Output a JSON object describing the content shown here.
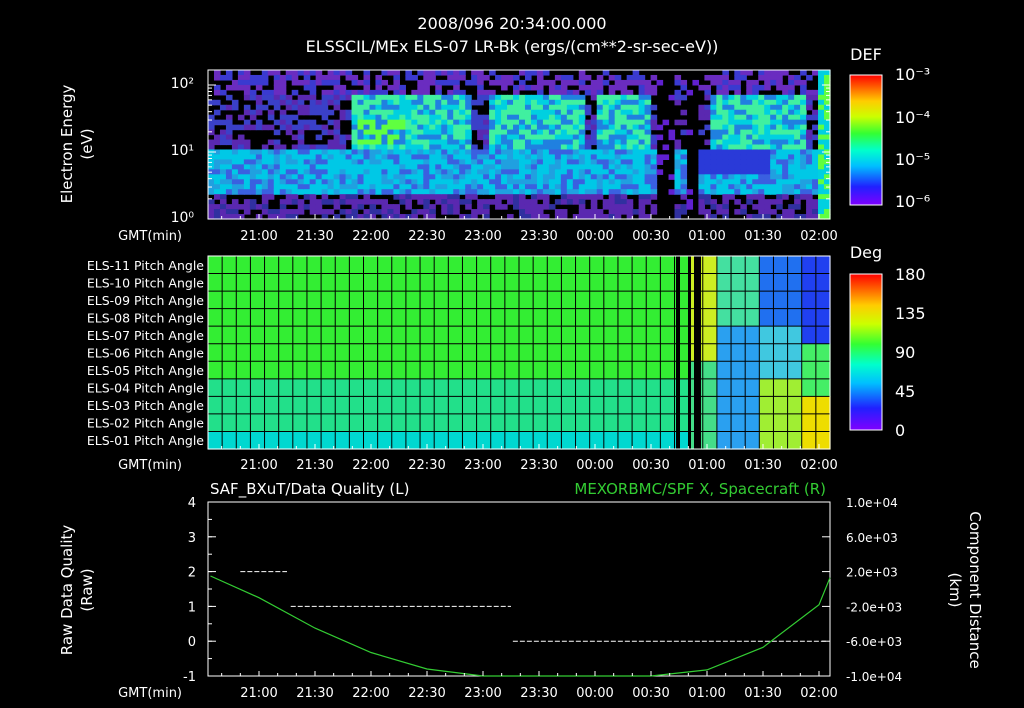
{
  "header": {
    "timestamp": "2008/096 20:34:00.000",
    "title": "ELSSCIL/MEx ELS-07 LR-Bk  (ergs/(cm**2-sr-sec-eV))"
  },
  "colors": {
    "background": "#000000",
    "axis": "#ffffff",
    "line_green": "#33cc33",
    "colorbar": [
      "#7f00ff",
      "#2020ff",
      "#00bfff",
      "#00ffcc",
      "#33ff33",
      "#ccff00",
      "#ffcc00",
      "#ff6600",
      "#ff0000"
    ]
  },
  "panel1": {
    "ylabel_line1": "Electron Energy",
    "ylabel_line2": "(eV)",
    "yticks": [
      "10⁰",
      "10¹",
      "10²"
    ],
    "colorbar_title": "DEF",
    "colorbar_ticks": [
      "10⁻³",
      "10⁻⁴",
      "10⁻⁵",
      "10⁻⁶"
    ]
  },
  "panel2": {
    "rows": [
      "ELS-11 Pitch Angle",
      "ELS-10 Pitch Angle",
      "ELS-09 Pitch Angle",
      "ELS-08 Pitch Angle",
      "ELS-07 Pitch Angle",
      "ELS-06 Pitch Angle",
      "ELS-05 Pitch Angle",
      "ELS-04 Pitch Angle",
      "ELS-03 Pitch Angle",
      "ELS-02 Pitch Angle",
      "ELS-01 Pitch Angle"
    ],
    "colorbar_title": "Deg",
    "colorbar_ticks": [
      "180",
      "135",
      "90",
      "45",
      "0"
    ]
  },
  "panel3": {
    "title_left": "SAF_BXuT/Data Quality (L)",
    "title_right": "MEXORBMC/SPF X, Spacecraft (R)",
    "ylabel_left_line1": "Raw Data Quality",
    "ylabel_left_line2": "(Raw)",
    "ylabel_right_line1": "Component Distance",
    "ylabel_right_line2": "(km)",
    "yticks_left": [
      "4",
      "3",
      "2",
      "1",
      "0",
      "-1"
    ],
    "yticks_right": [
      "1.0e+04",
      "6.0e+03",
      "2.0e+03",
      "-2.0e+03",
      "-6.0e+03",
      "-1.0e+04"
    ]
  },
  "time_axis": {
    "label": "GMT(min)",
    "ticks": [
      "21:00",
      "21:30",
      "22:00",
      "22:30",
      "23:00",
      "23:30",
      "00:00",
      "00:30",
      "01:00",
      "01:30",
      "02:00"
    ]
  },
  "chart_data": [
    {
      "type": "heatmap",
      "title": "ELSSCIL/MEx ELS-07 LR-Bk  (ergs/(cm**2-sr-sec-eV))",
      "xlabel": "GMT(min)",
      "ylabel": "Electron Energy (eV)",
      "yscale": "log",
      "ylim": [
        1,
        150
      ],
      "colorbar": {
        "label": "DEF",
        "scale": "log",
        "range": [
          1e-06,
          0.001
        ]
      },
      "x_range": [
        "20:34",
        "02:08"
      ]
    },
    {
      "type": "heatmap",
      "ylabel": "Pitch Angle (ELS-01 .. ELS-11)",
      "xlabel": "GMT(min)",
      "colorbar": {
        "label": "Deg",
        "range": [
          0,
          180
        ]
      },
      "x_range": [
        "20:34",
        "02:08"
      ]
    },
    {
      "type": "line",
      "xlabel": "GMT(min)",
      "series": [
        {
          "name": "SAF_BXuT/Data Quality (L)",
          "axis": "left",
          "ylim": [
            -1,
            4
          ],
          "segments": [
            {
              "x": [
                "20:50",
                "21:15"
              ],
              "y": 2
            },
            {
              "x": [
                "21:17",
                "23:15"
              ],
              "y": 1
            },
            {
              "x": [
                "23:16",
                "02:04"
              ],
              "y": 0
            }
          ]
        },
        {
          "name": "MEXORBMC/SPF X, Spacecraft (R)",
          "axis": "right",
          "ylim": [
            -10000,
            10000
          ],
          "points": [
            {
              "x": "20:34",
              "y": 1500
            },
            {
              "x": "21:00",
              "y": -1000
            },
            {
              "x": "21:30",
              "y": -4500
            },
            {
              "x": "22:00",
              "y": -7300
            },
            {
              "x": "22:30",
              "y": -9200
            },
            {
              "x": "23:00",
              "y": -10000
            },
            {
              "x": "23:30",
              "y": -10500
            },
            {
              "x": "00:00",
              "y": -10800
            },
            {
              "x": "00:30",
              "y": -10700
            },
            {
              "x": "01:00",
              "y": -9300
            },
            {
              "x": "01:30",
              "y": -6700
            },
            {
              "x": "02:00",
              "y": -1800
            },
            {
              "x": "02:08",
              "y": 1300
            }
          ]
        }
      ]
    }
  ]
}
